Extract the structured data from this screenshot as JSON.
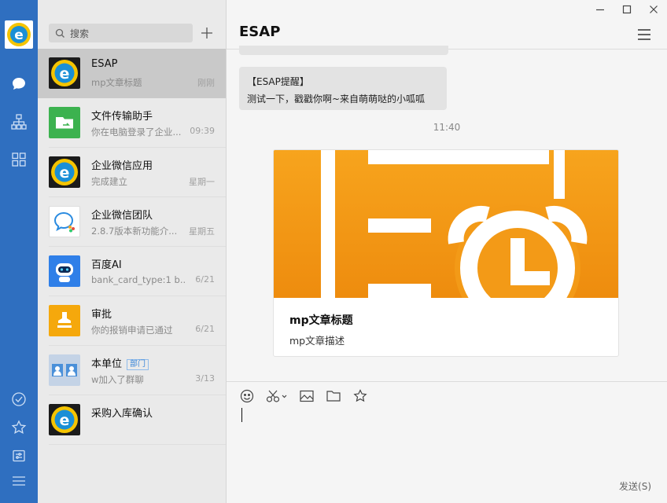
{
  "nav": {
    "icons": [
      "chat-icon",
      "org-icon",
      "apps-icon",
      "todo-icon",
      "favorites-icon",
      "settings-icon",
      "menu-icon"
    ]
  },
  "search": {
    "placeholder": "搜索"
  },
  "sessions": [
    {
      "name": "ESAP",
      "sub": "mp文章标题",
      "time": "刚刚",
      "avatar": "esap-logo"
    },
    {
      "name": "文件传输助手",
      "sub": "你在电脑登录了企业...",
      "time": "09:39",
      "avatar": "file-transfer"
    },
    {
      "name": "企业微信应用",
      "sub": "完成建立",
      "time": "星期一",
      "avatar": "esap-logo"
    },
    {
      "name": "企业微信团队",
      "sub": "2.8.7版本新功能介...",
      "time": "星期五",
      "avatar": "wework-team"
    },
    {
      "name": "百度AI",
      "sub": "bank_card_type:1 b...",
      "time": "6/21",
      "avatar": "baidu-ai"
    },
    {
      "name": "审批",
      "sub": "你的报销申请已通过",
      "time": "6/21",
      "avatar": "approval"
    },
    {
      "name": "本单位",
      "tag": "部门",
      "sub": "w加入了群聊",
      "time": "3/13",
      "avatar": "group"
    },
    {
      "name": "采购入库确认",
      "sub": "",
      "time": "",
      "avatar": "esap-logo"
    }
  ],
  "chat": {
    "title": "ESAP",
    "message_title": "【ESAP提醒】",
    "message_body": "测试一下，戳戳你啊~来自萌萌哒的小呱呱",
    "timestamp": "11:40",
    "card": {
      "title": "mp文章标题",
      "desc": "mp文章描述"
    },
    "send_label": "发送(S)"
  },
  "colors": {
    "nav": "#2f6fc0",
    "card_orange": "#f39a17",
    "active_item": "#c9c9c9"
  }
}
